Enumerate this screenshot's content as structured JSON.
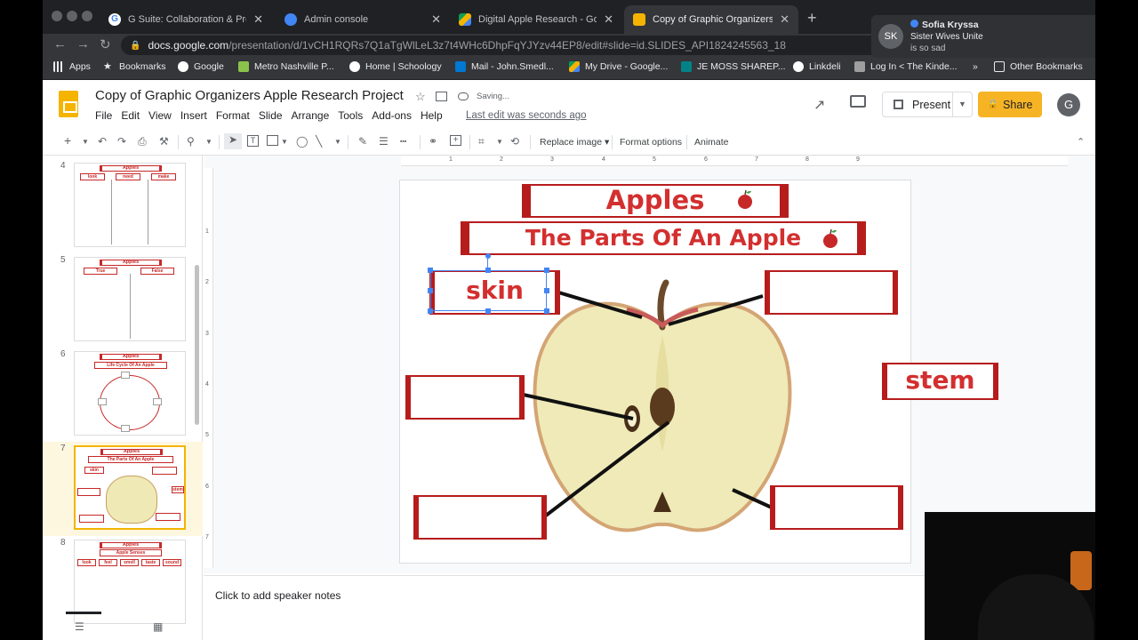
{
  "tabs": [
    {
      "title": "G Suite: Collaboration & Produ",
      "icon": "google-icon",
      "active": false
    },
    {
      "title": "Admin console",
      "icon": "admin-icon",
      "active": false
    },
    {
      "title": "Digital Apple Research - Googl",
      "icon": "drive-icon",
      "active": false
    },
    {
      "title": "Copy of Graphic Organizers Ap",
      "icon": "slides-icon",
      "active": true
    }
  ],
  "address": {
    "host": "docs.google.com",
    "path": "/presentation/d/1vCH1RQRs7Q1aTgWlLeL3z7t4WHc6DhpFqYJYzv44EP8/edit#slide=id.SLIDES_API1824245563_18"
  },
  "bookmarks": [
    "Apps",
    "Bookmarks",
    "Google",
    "Metro Nashville P...",
    "Home | Schoology",
    "Mail - John.Smedl...",
    "My Drive - Google...",
    "JE MOSS SHAREP...",
    "Linkdeli",
    "Log In < The Kinde...",
    "»",
    "Other Bookmarks"
  ],
  "notification": {
    "initials": "SK",
    "name": "Sofia Kryssa",
    "line1": "Sister Wives Unite",
    "line2": "is so sad"
  },
  "doc": {
    "title": "Copy of Graphic Organizers Apple Research Project",
    "status": "Saving...",
    "last_edit": "Last edit was seconds ago"
  },
  "menus": [
    "File",
    "Edit",
    "View",
    "Insert",
    "Format",
    "Slide",
    "Arrange",
    "Tools",
    "Add-ons",
    "Help"
  ],
  "header_buttons": {
    "present": "Present",
    "share": "Share",
    "account": "G"
  },
  "edit_toolbar": {
    "replace_image": "Replace image",
    "format_options": "Format options",
    "animate": "Animate"
  },
  "ruler_h": [
    "1",
    "2",
    "3",
    "4",
    "5",
    "6",
    "7",
    "8",
    "9"
  ],
  "ruler_v": [
    "1",
    "2",
    "3",
    "4",
    "5",
    "6",
    "7"
  ],
  "filmstrip": [
    {
      "num": "4",
      "title": "Apples",
      "cols": [
        "look",
        "need",
        "make"
      ]
    },
    {
      "num": "5",
      "title": "Apples",
      "cols": [
        "True",
        "False"
      ]
    },
    {
      "num": "6",
      "title": "Apples",
      "subtitle": "Life Cycle Of An Apple"
    },
    {
      "num": "7",
      "title": "Apples",
      "subtitle": "The Parts Of An Apple",
      "selected": true
    },
    {
      "num": "8",
      "title": "Apples",
      "subtitle": "Apple Senses",
      "cols": [
        "look",
        "feel",
        "smell",
        "taste",
        "sound"
      ]
    }
  ],
  "slide": {
    "title": "Apples",
    "subtitle": "The Parts Of An Apple",
    "labels": {
      "skin": "skin",
      "stem": "stem"
    }
  },
  "speaker_notes_placeholder": "Click to add speaker notes",
  "colors": {
    "accent_red": "#d32f2f",
    "border_red": "#b71c1c",
    "share_yellow": "#f6b425",
    "slides_yellow": "#f4b400"
  }
}
